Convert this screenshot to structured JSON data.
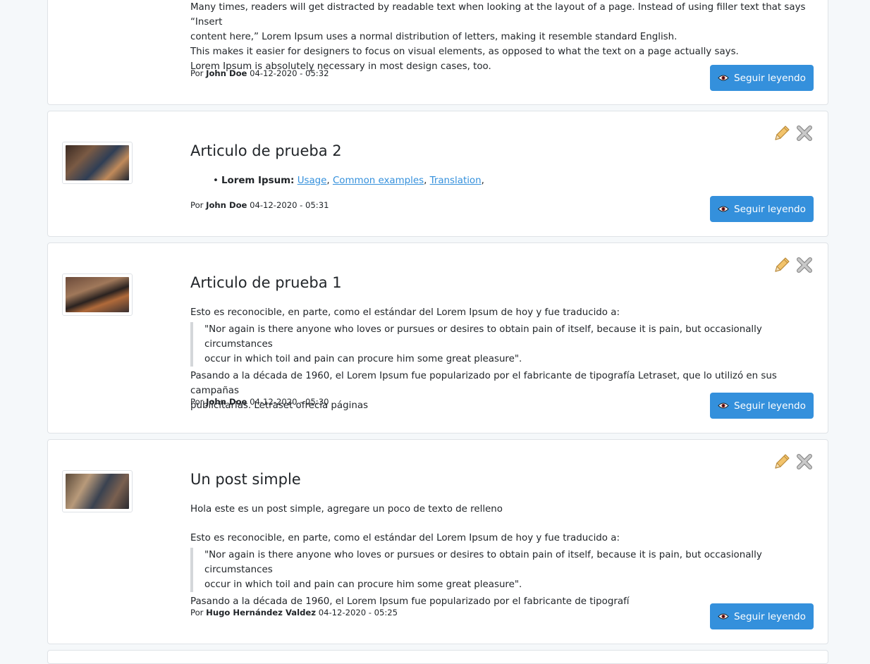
{
  "colors": {
    "accent": "#3490dc",
    "background": "#f5f8fa",
    "pencil": "#e8b75a",
    "close": "#b5b5b5"
  },
  "icons": {
    "edit": "pencil-icon",
    "delete": "close-icon",
    "view": "eye-icon"
  },
  "by_label": "Por",
  "read_more_label": "Seguir leyendo",
  "post0": {
    "lines": [
      "Many times, readers will get distracted by readable text when looking at the layout of a page. Instead of using filler text that says “Insert",
      "content here,” Lorem Ipsum uses a normal distribution of letters, making it resemble standard English.",
      "This makes it easier for designers to focus on visual elements, as opposed to what the text on a page actually says.",
      "Lorem Ipsum is absolutely necessary in most design cases, too."
    ],
    "author": "John Doe",
    "date": "04-12-2020 - 05:32"
  },
  "post1": {
    "title": "Articulo de prueba 2",
    "list_label": "Lorem Ipsum:",
    "links": [
      "Usage",
      "Common examples",
      "Translation"
    ],
    "author": "John Doe",
    "date": "04-12-2020 - 05:31"
  },
  "post2": {
    "title": "Articulo de prueba 1",
    "intro": "Esto es reconocible, en parte, como el estándar del Lorem Ipsum de hoy y fue traducido a:",
    "quote_lines": [
      "\"Nor again is there anyone who loves or pursues or desires to obtain pain of itself, because it is pain, but occasionally circumstances",
      "occur in which toil and pain can procure him some great pleasure\"."
    ],
    "outro_lines": [
      "Pasando a la década de 1960, el Lorem Ipsum fue popularizado por el fabricante de tipografía Letraset, que lo utilizó en sus campañas",
      "publicitarias. Letraset ofrecía páginas"
    ],
    "author": "John Doe",
    "date": "04-12-2020 - 05:30"
  },
  "post3": {
    "title": "Un post simple",
    "lead": "Hola este es un post simple, agregare un poco de texto de relleno",
    "intro": "Esto es reconocible, en parte, como el estándar del Lorem Ipsum de hoy y fue traducido a:",
    "quote_lines": [
      "\"Nor again is there anyone who loves or pursues or desires to obtain pain of itself, because it is pain, but occasionally circumstances",
      "occur in which toil and pain can procure him some great pleasure\"."
    ],
    "outro": "Pasando a la década de 1960, el Lorem Ipsum fue popularizado por el fabricante de tipografí",
    "author": "Hugo Hernández Valdez",
    "date": "04-12-2020 - 05:25"
  }
}
